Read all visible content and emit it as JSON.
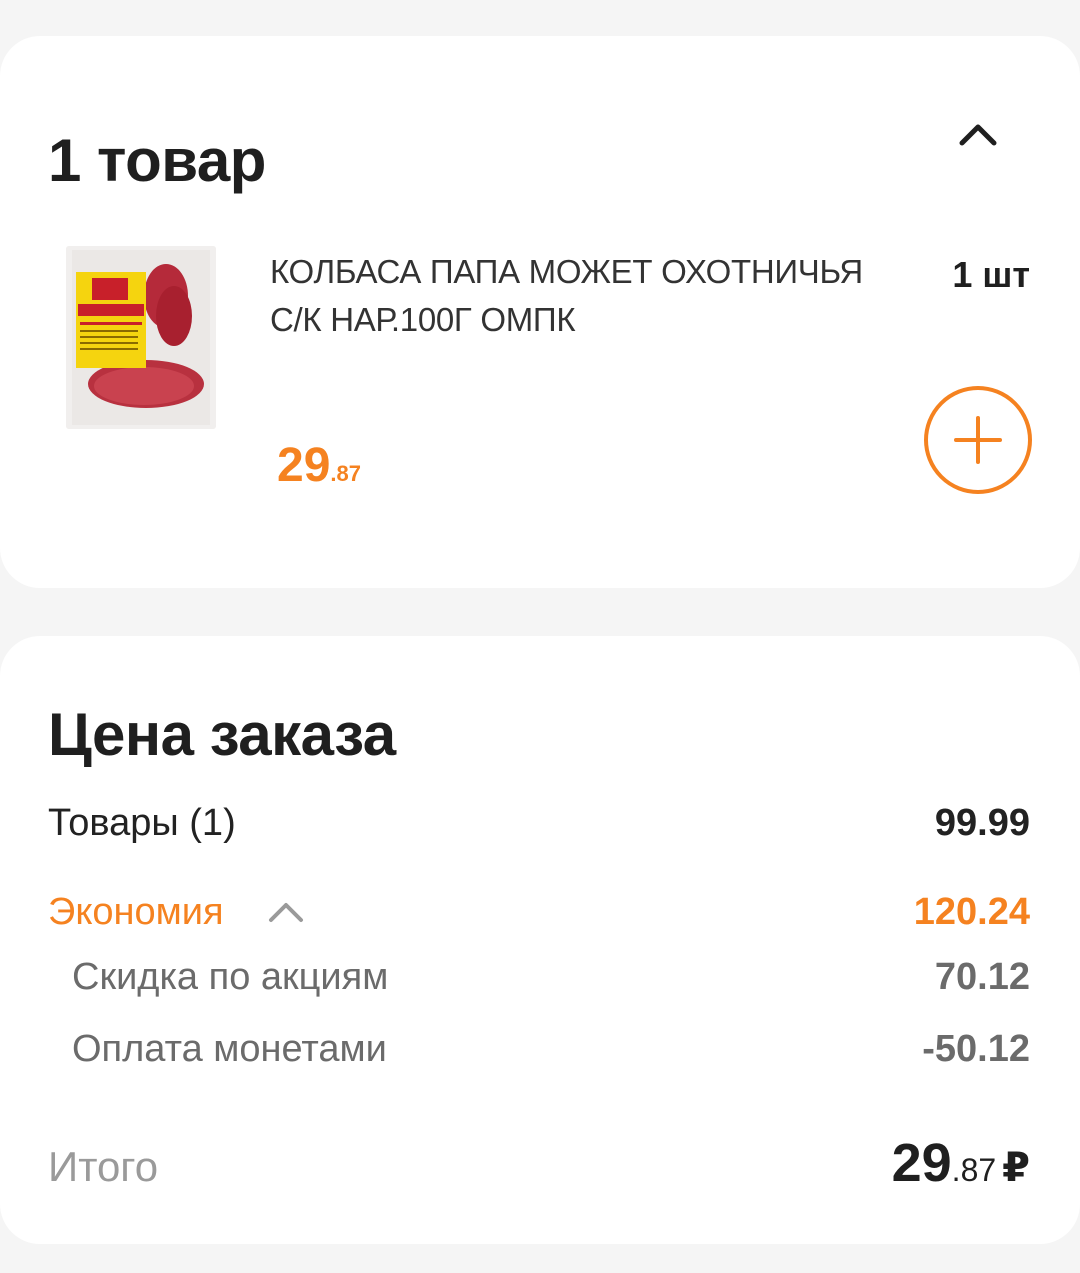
{
  "items_card": {
    "title": "1 товар",
    "collapse_icon": "chevron-up-icon"
  },
  "product": {
    "name": "КОЛБАСА ПАПА МОЖЕТ ОХОТНИЧЬЯ С/К НАР.100Г ОМПК",
    "quantity": "1 шт",
    "price_int": "29",
    "price_dec": ".87",
    "image_alt": "ПАПА МОЖЕТ ОХОТНИЧЬЯ",
    "add_icon": "plus-icon"
  },
  "summary": {
    "title": "Цена заказа",
    "goods_label": "Товары (1)",
    "goods_value": "99.99",
    "economy_label": "Экономия",
    "economy_value": "120.24",
    "discount_label": "Скидка по акциям",
    "discount_value": "70.12",
    "coins_label": "Оплата монетами",
    "coins_value": "-50.12",
    "total_label": "Итого",
    "total_int": "29",
    "total_dec": ".87",
    "currency": "₽"
  },
  "colors": {
    "accent": "#f58220",
    "background": "#f5f5f5",
    "card": "#ffffff"
  }
}
